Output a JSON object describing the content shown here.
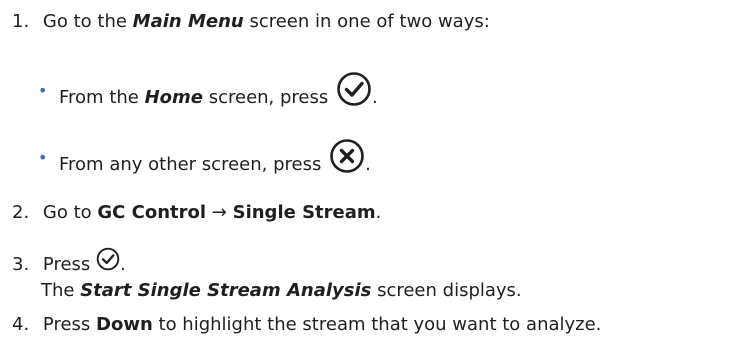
{
  "steps": [
    {
      "number": "1.",
      "pre": "Go to the ",
      "em": "Main Menu",
      "post": " screen in one of two ways:",
      "bullets": [
        {
          "pre": "From the ",
          "em": "Home",
          "post": " screen, press",
          "icon": "check-circle-icon",
          "after": "."
        },
        {
          "pre": "From any other screen, press",
          "icon": "x-circle-icon",
          "after": "."
        }
      ]
    },
    {
      "number": "2.",
      "pre": "Go to ",
      "b1": "GC Control",
      "arrow": " → ",
      "b2": "Single Stream",
      "post": "."
    },
    {
      "number": "3.",
      "pre": "Press",
      "icon": "check-circle-icon",
      "after": ".",
      "result_pre": "The ",
      "result_em": "Start Single Stream Analysis",
      "result_post": " screen displays."
    },
    {
      "number": "4.",
      "pre": "Press ",
      "b1": "Down",
      "post": " to highlight the stream that you want to analyze."
    }
  ]
}
